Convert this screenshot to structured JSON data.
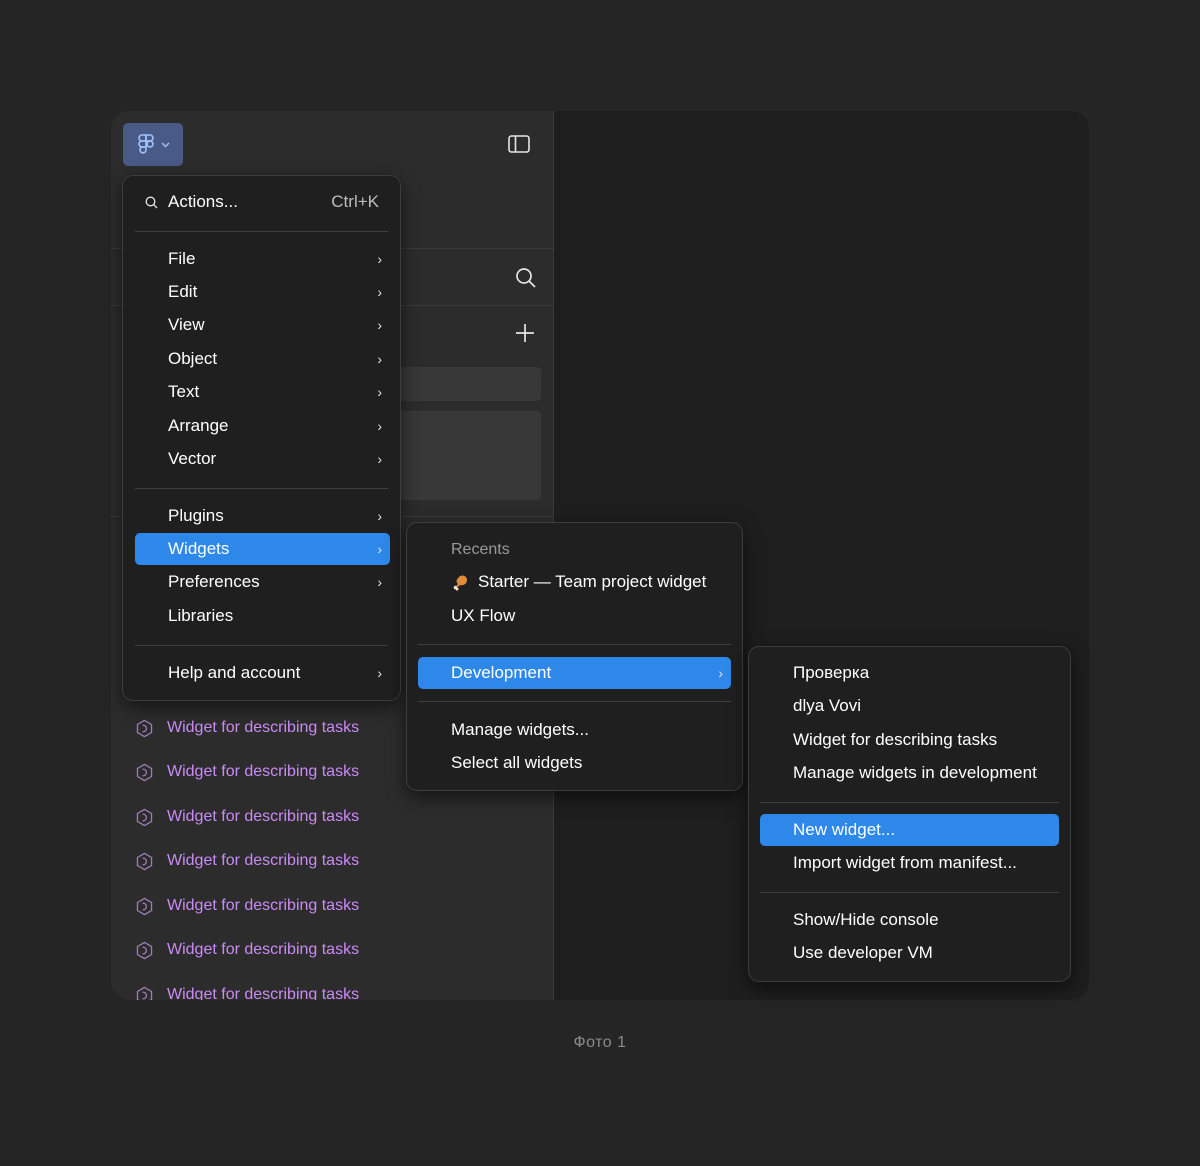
{
  "main_menu": {
    "actions_label": "Actions...",
    "actions_shortcut": "Ctrl+K",
    "items": [
      {
        "label": "File",
        "has_submenu": true
      },
      {
        "label": "Edit",
        "has_submenu": true
      },
      {
        "label": "View",
        "has_submenu": true
      },
      {
        "label": "Object",
        "has_submenu": true
      },
      {
        "label": "Text",
        "has_submenu": true
      },
      {
        "label": "Arrange",
        "has_submenu": true
      },
      {
        "label": "Vector",
        "has_submenu": true
      },
      {
        "label": "Plugins",
        "has_submenu": true
      },
      {
        "label": "Widgets",
        "has_submenu": true,
        "active": true
      },
      {
        "label": "Preferences",
        "has_submenu": true
      },
      {
        "label": "Libraries",
        "has_submenu": false
      },
      {
        "label": "Help and account",
        "has_submenu": true
      }
    ]
  },
  "widgets_menu": {
    "recents_heading": "Recents",
    "recents": [
      {
        "label": "Starter — Team project widget",
        "icon": "drumstick-emoji-icon"
      },
      {
        "label": "UX Flow"
      }
    ],
    "development_label": "Development",
    "manage_label": "Manage widgets...",
    "select_all_label": "Select all widgets"
  },
  "development_menu": {
    "items": [
      "Проверка",
      "dlya Vovi",
      "Widget for describing tasks",
      "Manage widgets in development"
    ],
    "new_widget_label": "New widget...",
    "import_label": "Import widget from manifest...",
    "console_label": "Show/Hide console",
    "vm_label": "Use developer VM"
  },
  "sidebar": {
    "widgets": [
      "Widget for describing tasks",
      "Widget for describing tasks",
      "Widget for describing tasks",
      "Widget for describing tasks",
      "Widget for describing tasks",
      "Widget for describing tasks",
      "Widget for describing tasks"
    ]
  },
  "caption": "Фото 1",
  "colors": {
    "accent": "#2d88ea",
    "widget_text": "#c98cf5",
    "menu_bg": "#1f1f1f",
    "page_bg": "#252525"
  }
}
